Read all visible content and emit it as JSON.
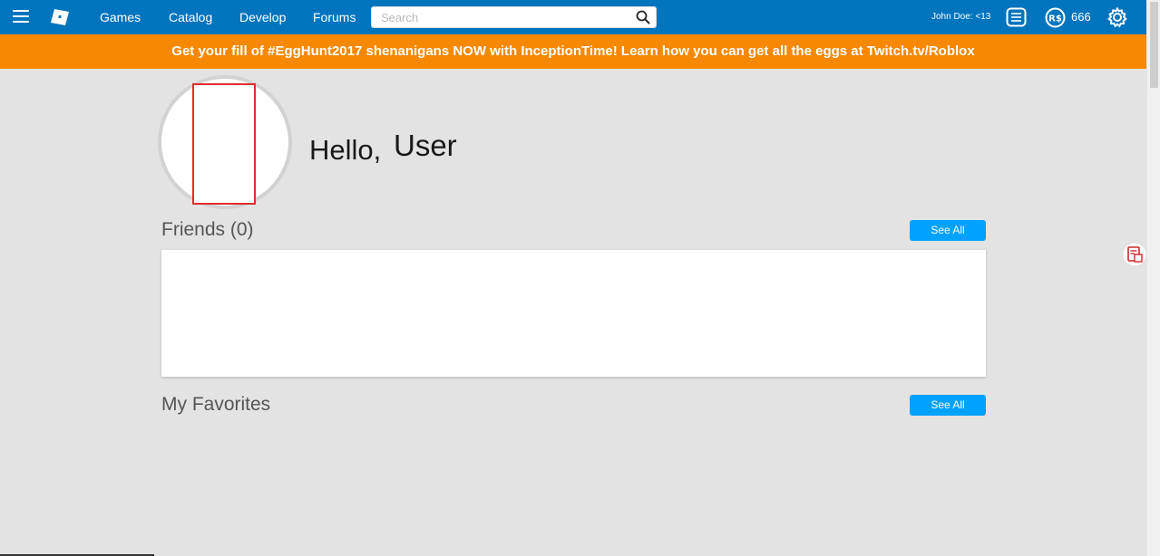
{
  "nav": {
    "links": [
      "Games",
      "Catalog",
      "Develop",
      "Forums"
    ],
    "search_placeholder": "Search",
    "user_label": "John Doe: <13",
    "robux": "666"
  },
  "banner": {
    "text": "Get your fill of #EggHunt2017 shenanigans NOW with InceptionTime! Learn how you can get all the eggs at Twitch.tv/Roblox"
  },
  "home": {
    "greeting": "Hello,",
    "username": "User"
  },
  "friends": {
    "title": "Friends (0)",
    "see_all": "See All"
  },
  "favorites": {
    "title": "My Favorites",
    "see_all": "See All"
  },
  "colors": {
    "nav_bg": "#0074bd",
    "banner_bg": "#f68802",
    "button_bg": "#00a2ff",
    "page_bg": "#e3e3e3"
  }
}
